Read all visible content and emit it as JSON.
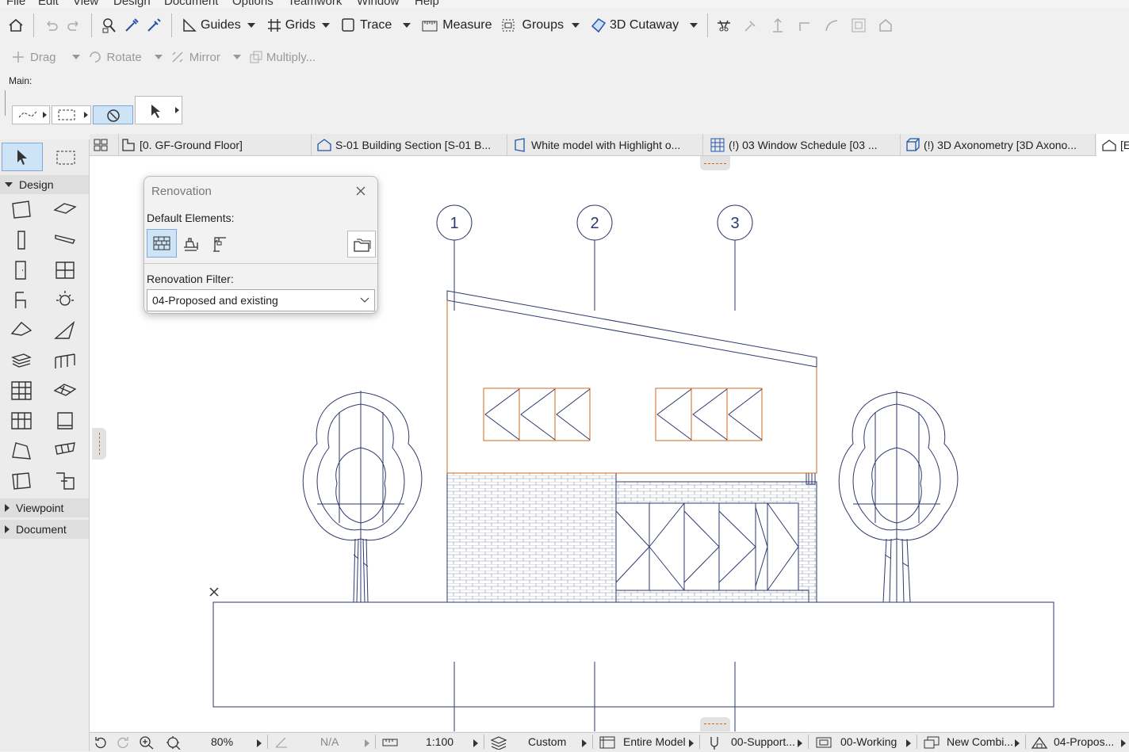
{
  "menu": [
    "File",
    "Edit",
    "View",
    "Design",
    "Document",
    "Options",
    "Teamwork",
    "Window",
    "Help"
  ],
  "toolbar1": {
    "guides": "Guides",
    "grids": "Grids",
    "trace": "Trace",
    "measure": "Measure",
    "groups": "Groups",
    "cutaway": "3D Cutaway"
  },
  "toolbar2": {
    "drag": "Drag",
    "rotate": "Rotate",
    "mirror": "Mirror",
    "multiply": "Multiply..."
  },
  "main_label": "Main:",
  "tabs": [
    "[0. GF-Ground Floor]",
    "S-01 Building Section [S-01 B...",
    "White model with Highlight o...",
    "(!) 03 Window Schedule [03 ...",
    "(!) 3D Axonometry [3D Axono...",
    "[E"
  ],
  "toolbox": {
    "sections": [
      "Design",
      "Viewpoint",
      "Document"
    ]
  },
  "palette": {
    "title": "Renovation",
    "default_elements_label": "Default Elements:",
    "filter_label": "Renovation Filter:",
    "filter_value": "04-Proposed and existing"
  },
  "grid_markers": [
    "1",
    "2",
    "3"
  ],
  "statusbar": {
    "zoom": "80%",
    "angle": "N/A",
    "scale": "1:100",
    "layer_combo": "Custom",
    "model_view": "Entire Model",
    "pen_set": "00-Support...",
    "dim": "00-Working",
    "graphic_override": "New Combi...",
    "renovation": "04-Propos..."
  },
  "colors": {
    "accent": "#cde4f7",
    "drawing_line": "#2e3a6e",
    "renovation_orange": "#d2691e"
  }
}
